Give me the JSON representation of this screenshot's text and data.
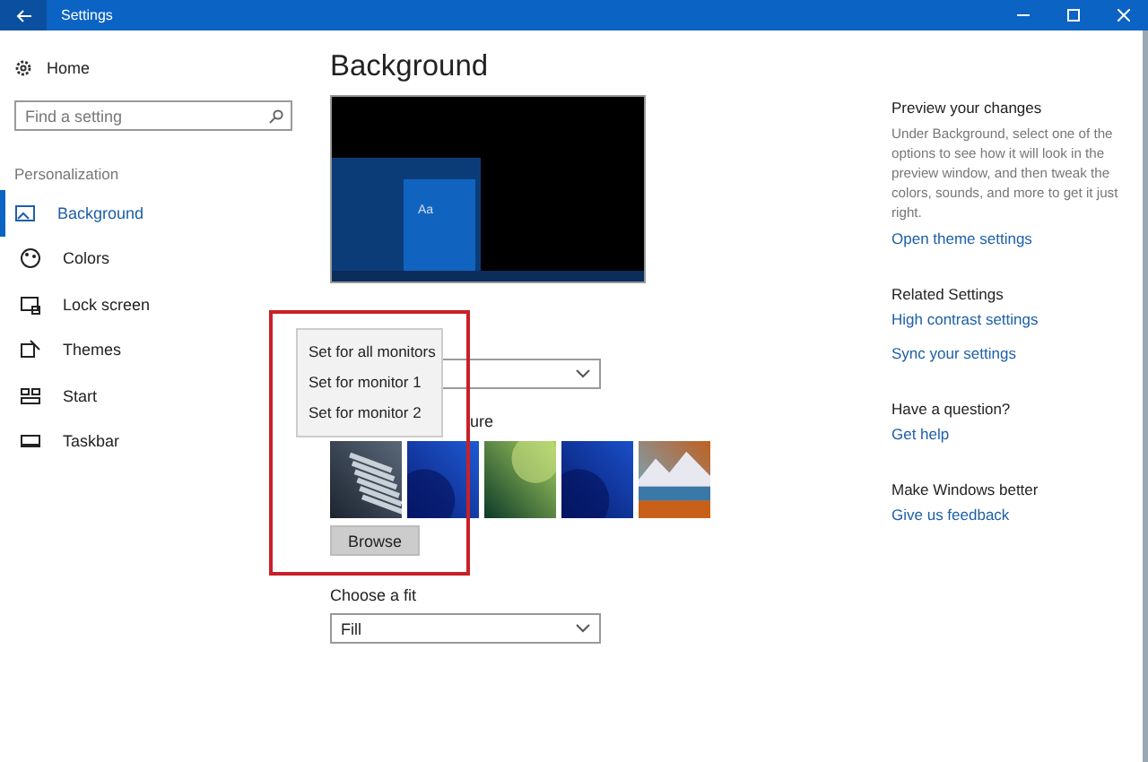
{
  "window": {
    "title": "Settings"
  },
  "sidebar": {
    "home": "Home",
    "search": {
      "placeholder": "Find a setting"
    },
    "section": "Personalization",
    "items": [
      {
        "label": "Background",
        "selected": true
      },
      {
        "label": "Colors",
        "selected": false
      },
      {
        "label": "Lock screen",
        "selected": false
      },
      {
        "label": "Themes",
        "selected": false
      },
      {
        "label": "Start",
        "selected": false
      },
      {
        "label": "Taskbar",
        "selected": false
      }
    ]
  },
  "main": {
    "title": "Background",
    "preview": {
      "tile_text": "Aa"
    },
    "picture_label": "ure",
    "browse": "Browse",
    "fit_label": "Choose a fit",
    "fit_value": "Fill"
  },
  "context_menu": {
    "items": [
      "Set for all monitors",
      "Set for monitor 1",
      "Set for monitor 2"
    ]
  },
  "right_panel": {
    "sections": [
      {
        "heading": "Preview your changes",
        "text": "Under Background, select one of the options to see how it will look in the preview window, and then tweak the colors, sounds, and more to get it just right.",
        "links": [
          "Open theme settings"
        ]
      },
      {
        "heading": "Related Settings",
        "links": [
          "High contrast settings",
          "Sync your settings"
        ]
      },
      {
        "heading": "Have a question?",
        "links": [
          "Get help"
        ]
      },
      {
        "heading": "Make Windows better",
        "links": [
          "Give us feedback"
        ]
      }
    ]
  }
}
